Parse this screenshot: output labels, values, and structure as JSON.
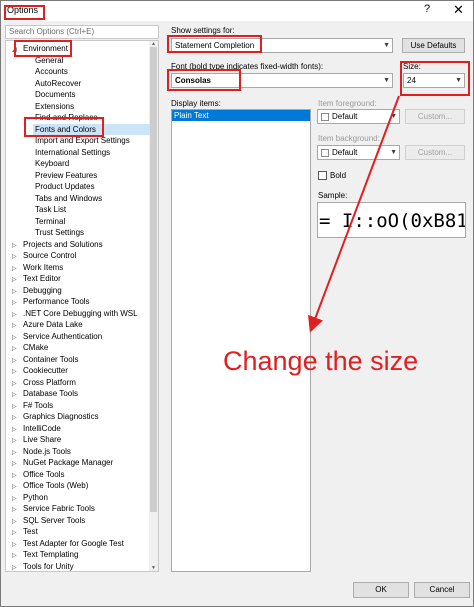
{
  "window": {
    "title": "Options",
    "help_label": "?",
    "close_label": "✕"
  },
  "search": {
    "placeholder": "Search Options (Ctrl+E)"
  },
  "tree": {
    "environment_label": "Environment",
    "environment_children": [
      "General",
      "Accounts",
      "AutoRecover",
      "Documents",
      "Extensions",
      "Find and Replace",
      "Fonts and Colors",
      "Import and Export Settings",
      "International Settings",
      "Keyboard",
      "Preview Features",
      "Product Updates",
      "Tabs and Windows",
      "Task List",
      "Terminal",
      "Trust Settings"
    ],
    "selected_child": "Fonts and Colors",
    "categories": [
      "Projects and Solutions",
      "Source Control",
      "Work Items",
      "Text Editor",
      "Debugging",
      "Performance Tools",
      ".NET Core Debugging with WSL",
      "Azure Data Lake",
      "Service Authentication",
      "CMake",
      "Container Tools",
      "Cookiecutter",
      "Cross Platform",
      "Database Tools",
      "F# Tools",
      "Graphics Diagnostics",
      "IntelliCode",
      "Live Share",
      "Node.js Tools",
      "NuGet Package Manager",
      "Office Tools",
      "Office Tools (Web)",
      "Python",
      "Service Fabric Tools",
      "SQL Server Tools",
      "Test",
      "Test Adapter for Google Test",
      "Text Templating",
      "Tools for Unity"
    ]
  },
  "settings": {
    "show_settings_label": "Show settings for:",
    "show_settings_value": "Statement Completion",
    "use_defaults_label": "Use Defaults",
    "font_label": "Font (bold type indicates fixed-width fonts):",
    "font_value": "Consolas",
    "size_label": "Size:",
    "size_value": "24",
    "display_items_label": "Display items:",
    "display_items": [
      "Plain Text"
    ],
    "item_foreground_label": "Item foreground:",
    "item_foreground_value": "Default",
    "item_background_label": "Item background:",
    "item_background_value": "Default",
    "custom_label": "Custom...",
    "bold_label": "Bold",
    "sample_label": "Sample:",
    "sample_text": "= I::oO(0xB81"
  },
  "footer": {
    "ok_label": "OK",
    "cancel_label": "Cancel"
  },
  "annotation": {
    "text": "Change the size",
    "color": "#e02020"
  },
  "colors": {
    "selection": "#0078d7",
    "tree_selection": "#cce4f7",
    "highlight": "#e02020"
  }
}
